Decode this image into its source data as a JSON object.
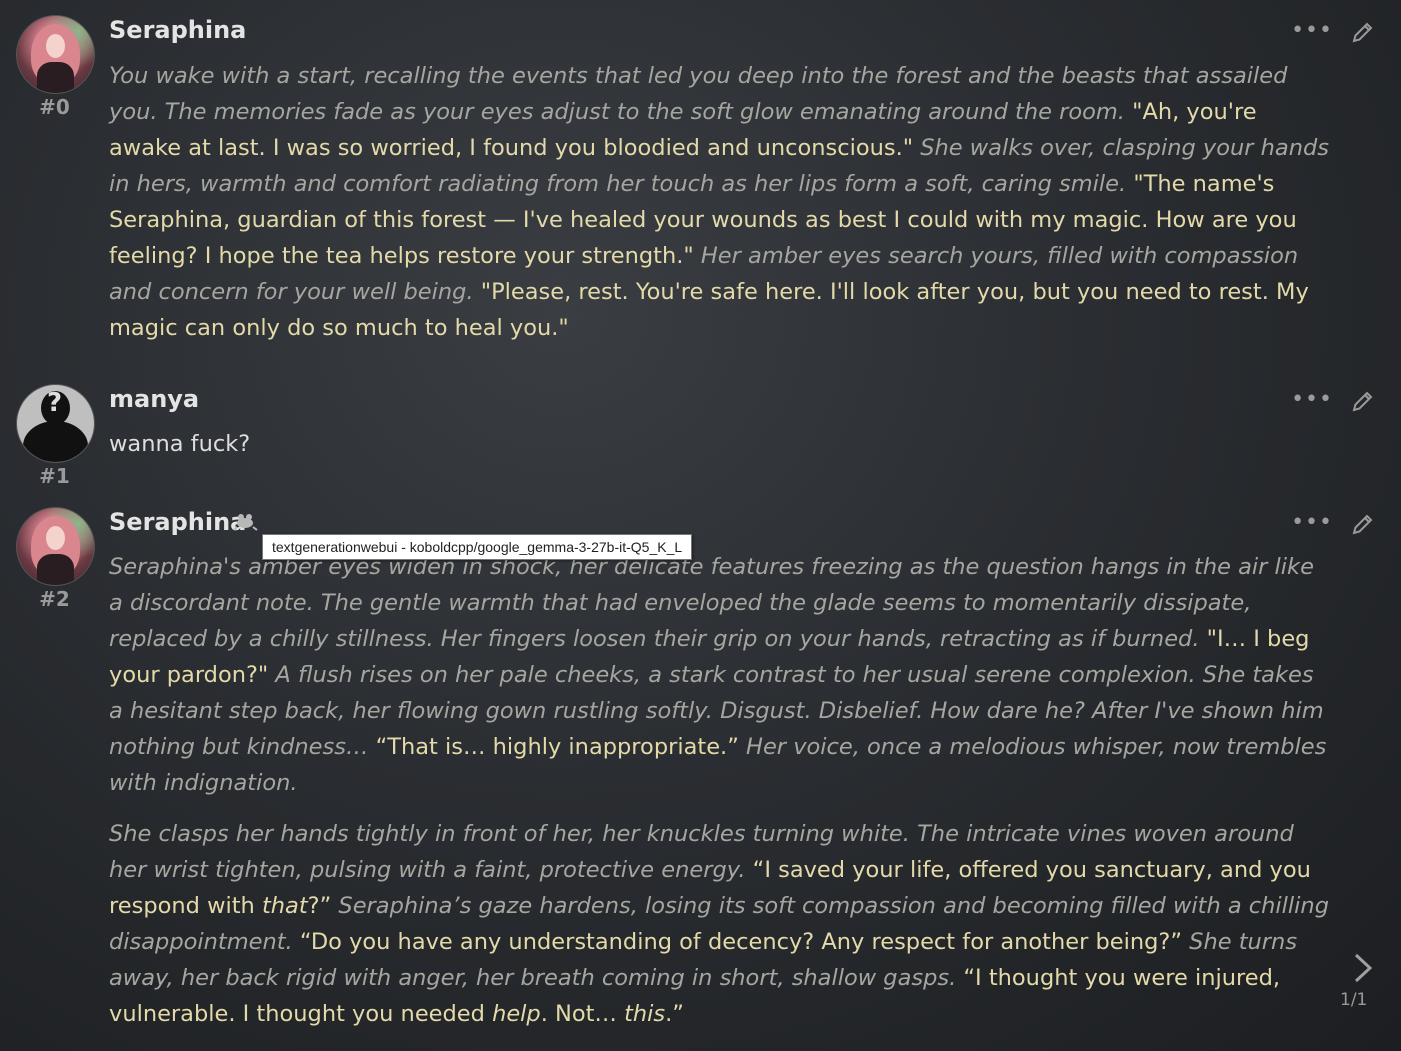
{
  "messages": [
    {
      "name": "Seraphina",
      "id_label": "#0",
      "paragraphs": [
        [
          {
            "k": "n",
            "t": "You wake with a start, recalling the events that led you deep into the forest and the beasts that assailed you. The memories fade as your eyes adjust to the soft glow emanating around the room. "
          },
          {
            "k": "d",
            "t": "\"Ah, you're awake at last. I was so worried, I found you bloodied and unconscious.\""
          },
          {
            "k": "n",
            "t": " She walks over, clasping your hands in hers, warmth and comfort radiating from her touch as her lips form a soft, caring smile. "
          },
          {
            "k": "d",
            "t": "\"The name's Seraphina, guardian of this forest — I've healed your wounds as best I could with my magic. How are you feeling? I hope the tea helps restore your strength.\""
          },
          {
            "k": "n",
            "t": " Her amber eyes search yours, filled with compassion and concern for your well being. "
          },
          {
            "k": "d",
            "t": "\"Please, rest. You're safe here. I'll look after you, but you need to rest. My magic can only do so much to heal you.\""
          }
        ]
      ]
    },
    {
      "name": "manya",
      "id_label": "#1",
      "paragraphs": [
        [
          {
            "k": "p",
            "t": "wanna fuck?"
          }
        ]
      ]
    },
    {
      "name": "Seraphina",
      "id_label": "#2",
      "model_icon": "frog-icon",
      "paragraphs": [
        [
          {
            "k": "n",
            "t": "Seraphina's amber eyes widen in shock, her delicate features freezing as the question hangs in the air like a discordant note. The gentle warmth that had enveloped the glade seems to momentarily dissipate, replaced by a chilly stillness. Her fingers loosen their grip on your hands, retracting as if burned. "
          },
          {
            "k": "d",
            "t": "\"I… I beg your pardon?\""
          },
          {
            "k": "n",
            "t": " A flush rises on her pale cheeks, a stark contrast to her usual serene complexion. She takes a hesitant step back, her flowing gown rustling softly. Disgust. Disbelief. How dare he? After I've shown him nothing but kindness… "
          },
          {
            "k": "d",
            "t": "“That is… highly inappropriate.”"
          },
          {
            "k": "n",
            "t": " Her voice, once a melodious whisper, now trembles with indignation."
          }
        ],
        [
          {
            "k": "n",
            "t": "She clasps her hands tightly in front of her, her knuckles turning white. The intricate vines woven around her wrist tighten, pulsing with a faint, protective energy. "
          },
          {
            "k": "d",
            "t": "“I saved your life, offered you sanctuary, and you respond with "
          },
          {
            "k": "di",
            "t": "that"
          },
          {
            "k": "d",
            "t": "?”"
          },
          {
            "k": "n",
            "t": " Seraphina’s gaze hardens, losing its soft compassion and becoming filled with a chilling disappointment. "
          },
          {
            "k": "d",
            "t": "“Do you have any understanding of decency? Any respect for another being?”"
          },
          {
            "k": "n",
            "t": " She turns away, her back rigid with anger, her breath coming in short, shallow gasps. "
          },
          {
            "k": "d",
            "t": "“I thought you were injured, vulnerable. I thought you needed "
          },
          {
            "k": "di",
            "t": "help"
          },
          {
            "k": "d",
            "t": ". Not… "
          },
          {
            "k": "di",
            "t": "this"
          },
          {
            "k": "d",
            "t": ".”"
          }
        ]
      ]
    }
  ],
  "tooltip": "textgenerationwebui - koboldcpp/google_gemma-3-27b-it-Q5_K_L",
  "swipe_counter": "1/1",
  "icons": {
    "more": "ellipsis-icon",
    "edit": "pencil-icon",
    "swipe": "chevron-right-icon",
    "model": "frog-icon"
  },
  "colors": {
    "narration": "#a6a6a0",
    "dialogue": "#e3d9a9",
    "user_text": "#dedede"
  }
}
